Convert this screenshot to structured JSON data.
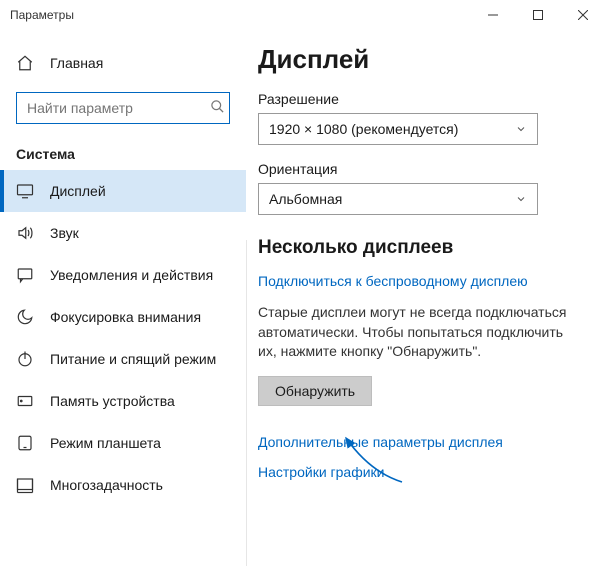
{
  "window": {
    "title": "Параметры"
  },
  "sidebar": {
    "home_label": "Главная",
    "search_placeholder": "Найти параметр",
    "section_label": "Система",
    "items": [
      {
        "label": "Дисплей"
      },
      {
        "label": "Звук"
      },
      {
        "label": "Уведомления и действия"
      },
      {
        "label": "Фокусировка внимания"
      },
      {
        "label": "Питание и спящий режим"
      },
      {
        "label": "Память устройства"
      },
      {
        "label": "Режим планшета"
      },
      {
        "label": "Многозадачность"
      }
    ]
  },
  "main": {
    "title": "Дисплей",
    "resolution": {
      "label": "Разрешение",
      "value": "1920 × 1080 (рекомендуется)"
    },
    "orientation": {
      "label": "Ориентация",
      "value": "Альбомная"
    },
    "multiple": {
      "title": "Несколько дисплеев",
      "wireless_link": "Подключиться к беспроводному дисплею",
      "note": "Старые дисплеи могут не всегда подключаться автоматически. Чтобы попытаться подключить их, нажмите кнопку \"Обнаружить\".",
      "detect_button": "Обнаружить",
      "advanced_link": "Дополнительные параметры дисплея",
      "graphics_link": "Настройки графики"
    }
  },
  "colors": {
    "accent": "#0067c0"
  }
}
